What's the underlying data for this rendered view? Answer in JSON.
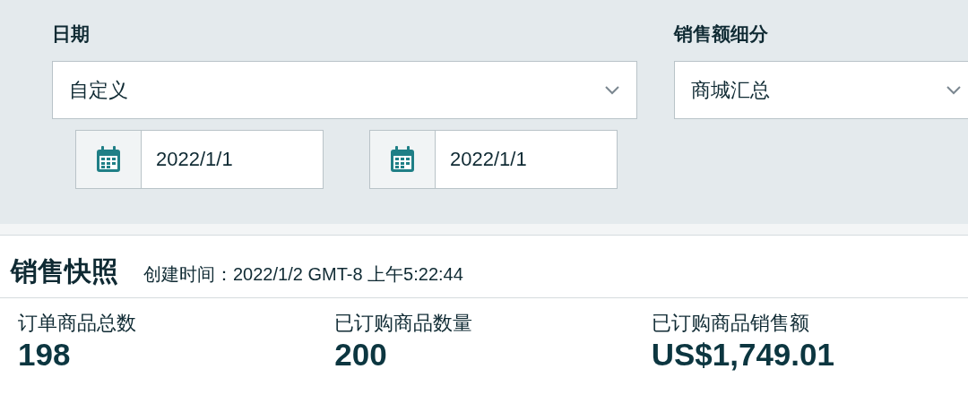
{
  "filters": [
    {
      "label": "日期",
      "value": "自定义"
    },
    {
      "label": "销售额细分",
      "value": "商城汇总"
    }
  ],
  "date_range": [
    {
      "value": "2022/1/1"
    },
    {
      "value": "2022/1/1"
    }
  ],
  "snapshot": {
    "title": "销售快照",
    "created": "创建时间：2022/1/2 GMT-8 上午5:22:44"
  },
  "metrics": [
    {
      "label": "订单商品总数",
      "value": "198"
    },
    {
      "label": "已订购商品数量",
      "value": "200"
    },
    {
      "label": "已订购商品销售额",
      "value": "US$1,749.01"
    }
  ]
}
